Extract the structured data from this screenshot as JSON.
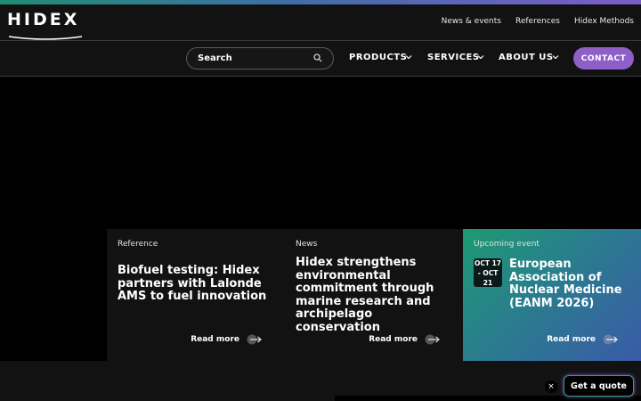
{
  "brand": {
    "logo": "HIDEX"
  },
  "top_links": [
    "News & events",
    "References",
    "Hidex Methods"
  ],
  "search": {
    "label": "Search"
  },
  "nav": {
    "products": "PRODUCTS",
    "services": "SERVICES",
    "about": "ABOUT US",
    "contact": "CONTACT"
  },
  "cards": [
    {
      "tag": "Reference",
      "title": "Biofuel testing: Hidex partners with Lalonde AMS to fuel innovation",
      "link": "Read more"
    },
    {
      "tag": "News",
      "title": "Hidex strengthens environmental commitment through marine research and archipelago conservation",
      "link": "Read more"
    },
    {
      "tag": "Upcoming event",
      "date": "OCT 17 - OCT 21",
      "title": "European Association of Nuclear Medicine (EANM 2026)",
      "link": "Read more"
    }
  ],
  "quote": {
    "label": "Get a quote",
    "close": "×"
  },
  "colors": {
    "accent_purple": "#8d5fc7",
    "accent_green": "#1d9a72",
    "accent_blue": "#3a5aa8"
  },
  "icons": {
    "search": "search-icon",
    "chevron": "chevron-down-icon",
    "arrow": "arrow-right-icon",
    "close": "close-icon"
  }
}
